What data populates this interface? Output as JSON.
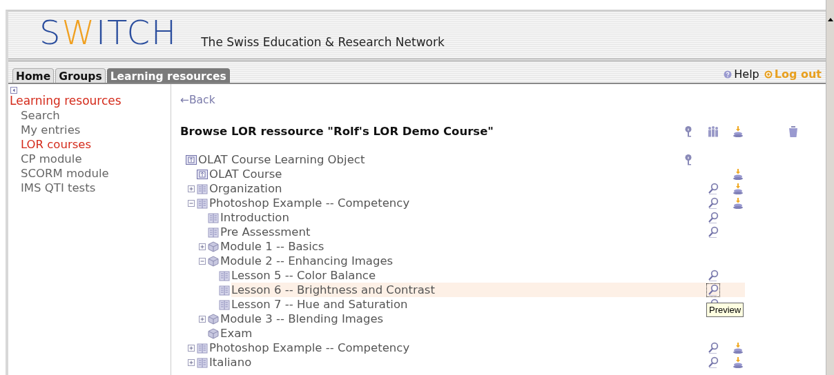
{
  "logo": [
    {
      "text": "S",
      "accent": false
    },
    {
      "text": "W",
      "accent": true
    },
    {
      "text": "ITCH",
      "accent": false
    }
  ],
  "tagline": "The Swiss Education & Research Network",
  "tabs": [
    {
      "label": "Home",
      "selected": false
    },
    {
      "label": "Groups",
      "selected": false
    },
    {
      "label": "Learning resources",
      "selected": true
    }
  ],
  "top_links": [
    {
      "kind": "help",
      "label": "Help"
    },
    {
      "kind": "logout",
      "label": "Log out"
    }
  ],
  "sidebar": {
    "heading": "Learning resources",
    "items": [
      {
        "label": "Search",
        "selected": false
      },
      {
        "label": "My entries",
        "selected": false
      },
      {
        "label": "LOR courses",
        "selected": true
      },
      {
        "label": "CP module",
        "selected": false
      },
      {
        "label": "SCORM module",
        "selected": false
      },
      {
        "label": "IMS QTI tests",
        "selected": false
      }
    ]
  },
  "back_link": "←Back",
  "title": "Browse LOR ressource \"Rolf's LOR Demo Course\"",
  "header_actions": [
    {
      "kind": "info"
    },
    {
      "kind": "members"
    },
    {
      "kind": "download"
    },
    {
      "kind": "delete"
    }
  ],
  "tree": [
    {
      "label": "OLAT Course Learning Object",
      "kind": "object",
      "selected": false,
      "actions": [
        {
          "kind": "info"
        }
      ],
      "children": [
        {
          "label": "OLAT Course",
          "kind": "object",
          "selected": false,
          "actions": [
            {
              "kind": "download"
            }
          ]
        },
        {
          "label": "Organization",
          "kind": "page",
          "expanded": false,
          "selected": false,
          "actions": [
            {
              "kind": "preview"
            },
            {
              "kind": "download"
            }
          ]
        },
        {
          "label": "Photoshop Example -- Competency",
          "kind": "page",
          "expanded": true,
          "selected": false,
          "actions": [
            {
              "kind": "preview"
            },
            {
              "kind": "download"
            }
          ],
          "children": [
            {
              "label": "Introduction",
              "kind": "page",
              "selected": false,
              "actions": [
                {
                  "kind": "preview"
                }
              ]
            },
            {
              "label": "Pre Assessment",
              "kind": "page",
              "selected": false,
              "actions": [
                {
                  "kind": "preview"
                }
              ]
            },
            {
              "label": "Module 1 -- Basics",
              "kind": "module",
              "expanded": false,
              "selected": false
            },
            {
              "label": "Module 2 -- Enhancing Images",
              "kind": "module",
              "expanded": true,
              "selected": false,
              "children": [
                {
                  "label": "Lesson 5 -- Color Balance",
                  "kind": "page",
                  "selected": false,
                  "actions": [
                    {
                      "kind": "preview"
                    }
                  ]
                },
                {
                  "label": "Lesson 6 -- Brightness and Contrast",
                  "kind": "page",
                  "selected": true,
                  "actions": [
                    {
                      "kind": "preview",
                      "focused": true,
                      "tooltip": "Preview"
                    }
                  ]
                },
                {
                  "label": "Lesson 7 -- Hue and Saturation",
                  "kind": "page",
                  "selected": false,
                  "actions": [
                    {
                      "kind": "preview"
                    }
                  ]
                }
              ]
            },
            {
              "label": "Module 3 -- Blending Images",
              "kind": "module",
              "expanded": false,
              "selected": false
            },
            {
              "label": "Exam",
              "kind": "module",
              "selected": false
            }
          ]
        },
        {
          "label": "Photoshop Example -- Competency",
          "kind": "page",
          "expanded": false,
          "selected": false,
          "actions": [
            {
              "kind": "preview"
            },
            {
              "kind": "download"
            }
          ]
        },
        {
          "label": "Italiano",
          "kind": "page",
          "expanded": false,
          "selected": false,
          "actions": [
            {
              "kind": "preview"
            },
            {
              "kind": "download"
            }
          ]
        }
      ]
    }
  ]
}
